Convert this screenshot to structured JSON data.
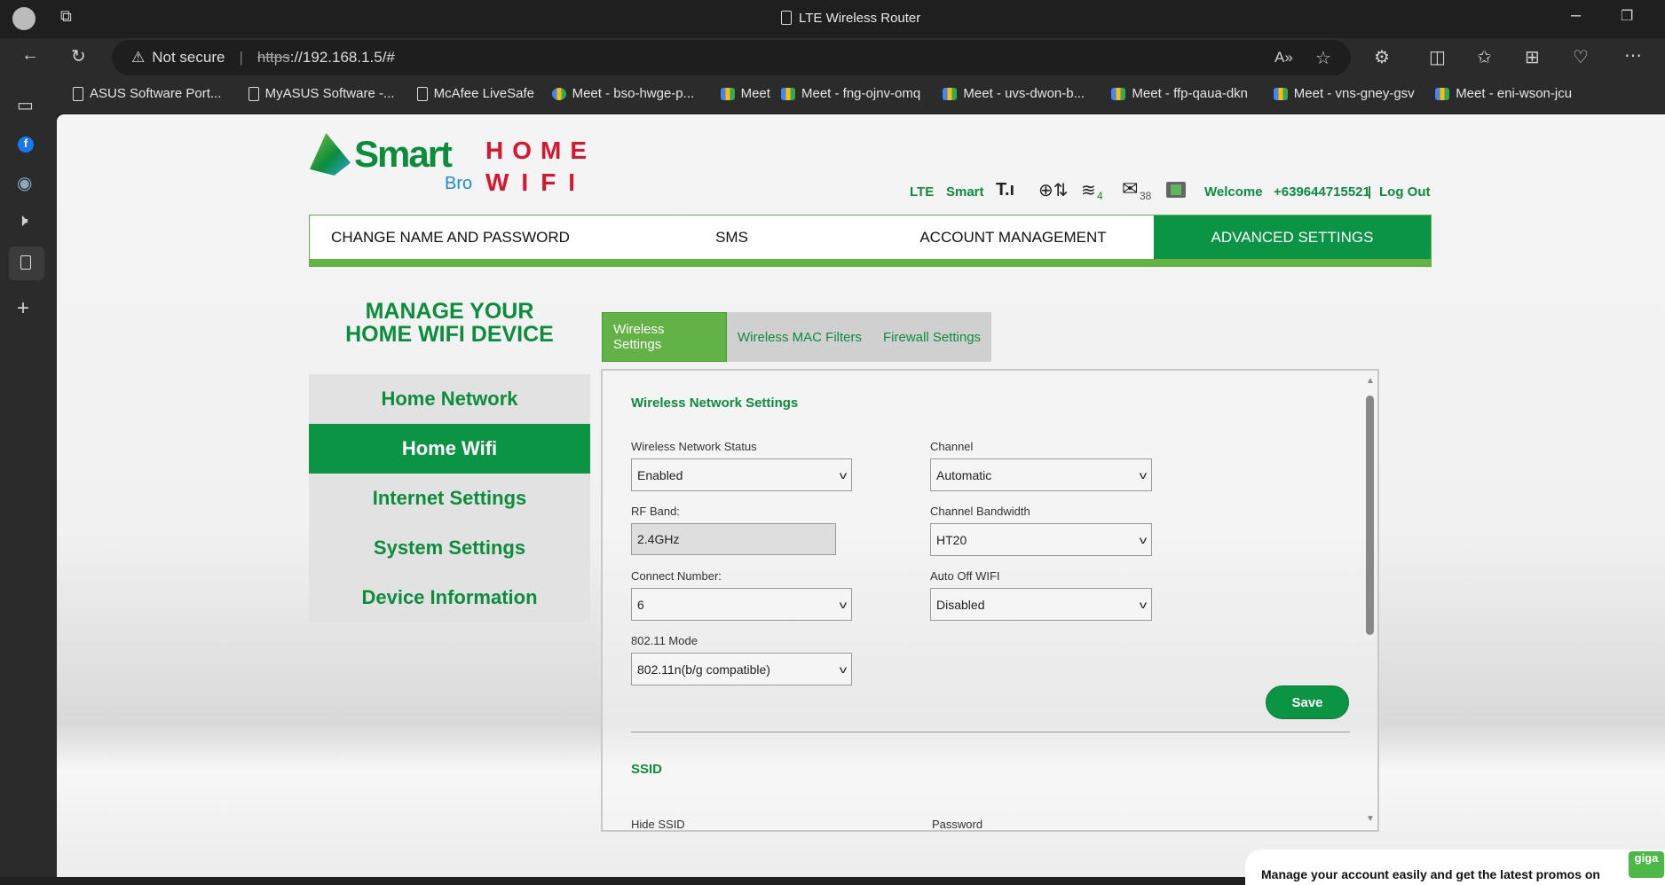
{
  "browser": {
    "title": "LTE Wireless Router",
    "not_secure": "Not secure",
    "url_scheme": "https",
    "url_rest": "://192.168.1.5/#",
    "bookmarks": [
      {
        "label": "ASUS Software Port...",
        "icon": "page"
      },
      {
        "label": "MyASUS Software -...",
        "icon": "page"
      },
      {
        "label": "McAfee LiveSafe",
        "icon": "page"
      },
      {
        "label": "Meet - bso-hwge-p...",
        "icon": "google"
      },
      {
        "label": "Meet",
        "icon": "meet"
      },
      {
        "label": "Meet - fng-ojnv-omq",
        "icon": "meet"
      },
      {
        "label": "Meet - uvs-dwon-b...",
        "icon": "meet"
      },
      {
        "label": "Meet - ffp-qaua-dkn",
        "icon": "meet"
      },
      {
        "label": "Meet - vns-gney-gsv",
        "icon": "meet"
      },
      {
        "label": "Meet - eni-wson-jcu",
        "icon": "meet"
      }
    ]
  },
  "logo": {
    "brand": "Smart",
    "sub": "Bro",
    "home": "HOME",
    "wifi": "WIFI"
  },
  "status": {
    "network": "LTE",
    "operator": "Smart",
    "wifi_clients": "4",
    "sms_count": "38",
    "welcome": "Welcome",
    "phone": "+639644715521",
    "separator": "|",
    "logout": "Log Out"
  },
  "nav": [
    "CHANGE NAME AND PASSWORD",
    "SMS",
    "ACCOUNT MANAGEMENT",
    "ADVANCED SETTINGS"
  ],
  "left": {
    "heading1": "MANAGE YOUR",
    "heading2": "HOME WIFI DEVICE",
    "menu": [
      "Home Network",
      "Home Wifi",
      "Internet Settings",
      "System Settings",
      "Device Information"
    ]
  },
  "tabs": [
    "Wireless Settings",
    "Wireless MAC Filters",
    "Firewall Settings"
  ],
  "form": {
    "section": "Wireless Network Settings",
    "status_label": "Wireless Network Status",
    "status_value": "Enabled",
    "channel_label": "Channel",
    "channel_value": "Automatic",
    "rf_label": "RF Band:",
    "rf_value": "2.4GHz",
    "bw_label": "Channel Bandwidth",
    "bw_value": "HT20",
    "connect_label": "Connect Number:",
    "connect_value": "6",
    "autooff_label": "Auto Off WIFI",
    "autooff_value": "Disabled",
    "mode_label": "802.11 Mode",
    "mode_value": "802.11n(b/g compatible)",
    "save": "Save",
    "ssid_section": "SSID",
    "hide_ssid_label": "Hide SSID",
    "password_label": "Password"
  },
  "promo": {
    "text": "Manage your account easily and get the latest promos on",
    "logo": "giga"
  },
  "colors": {
    "green": "#0b9444",
    "light_green": "#63b245",
    "red": "#d7172f"
  }
}
